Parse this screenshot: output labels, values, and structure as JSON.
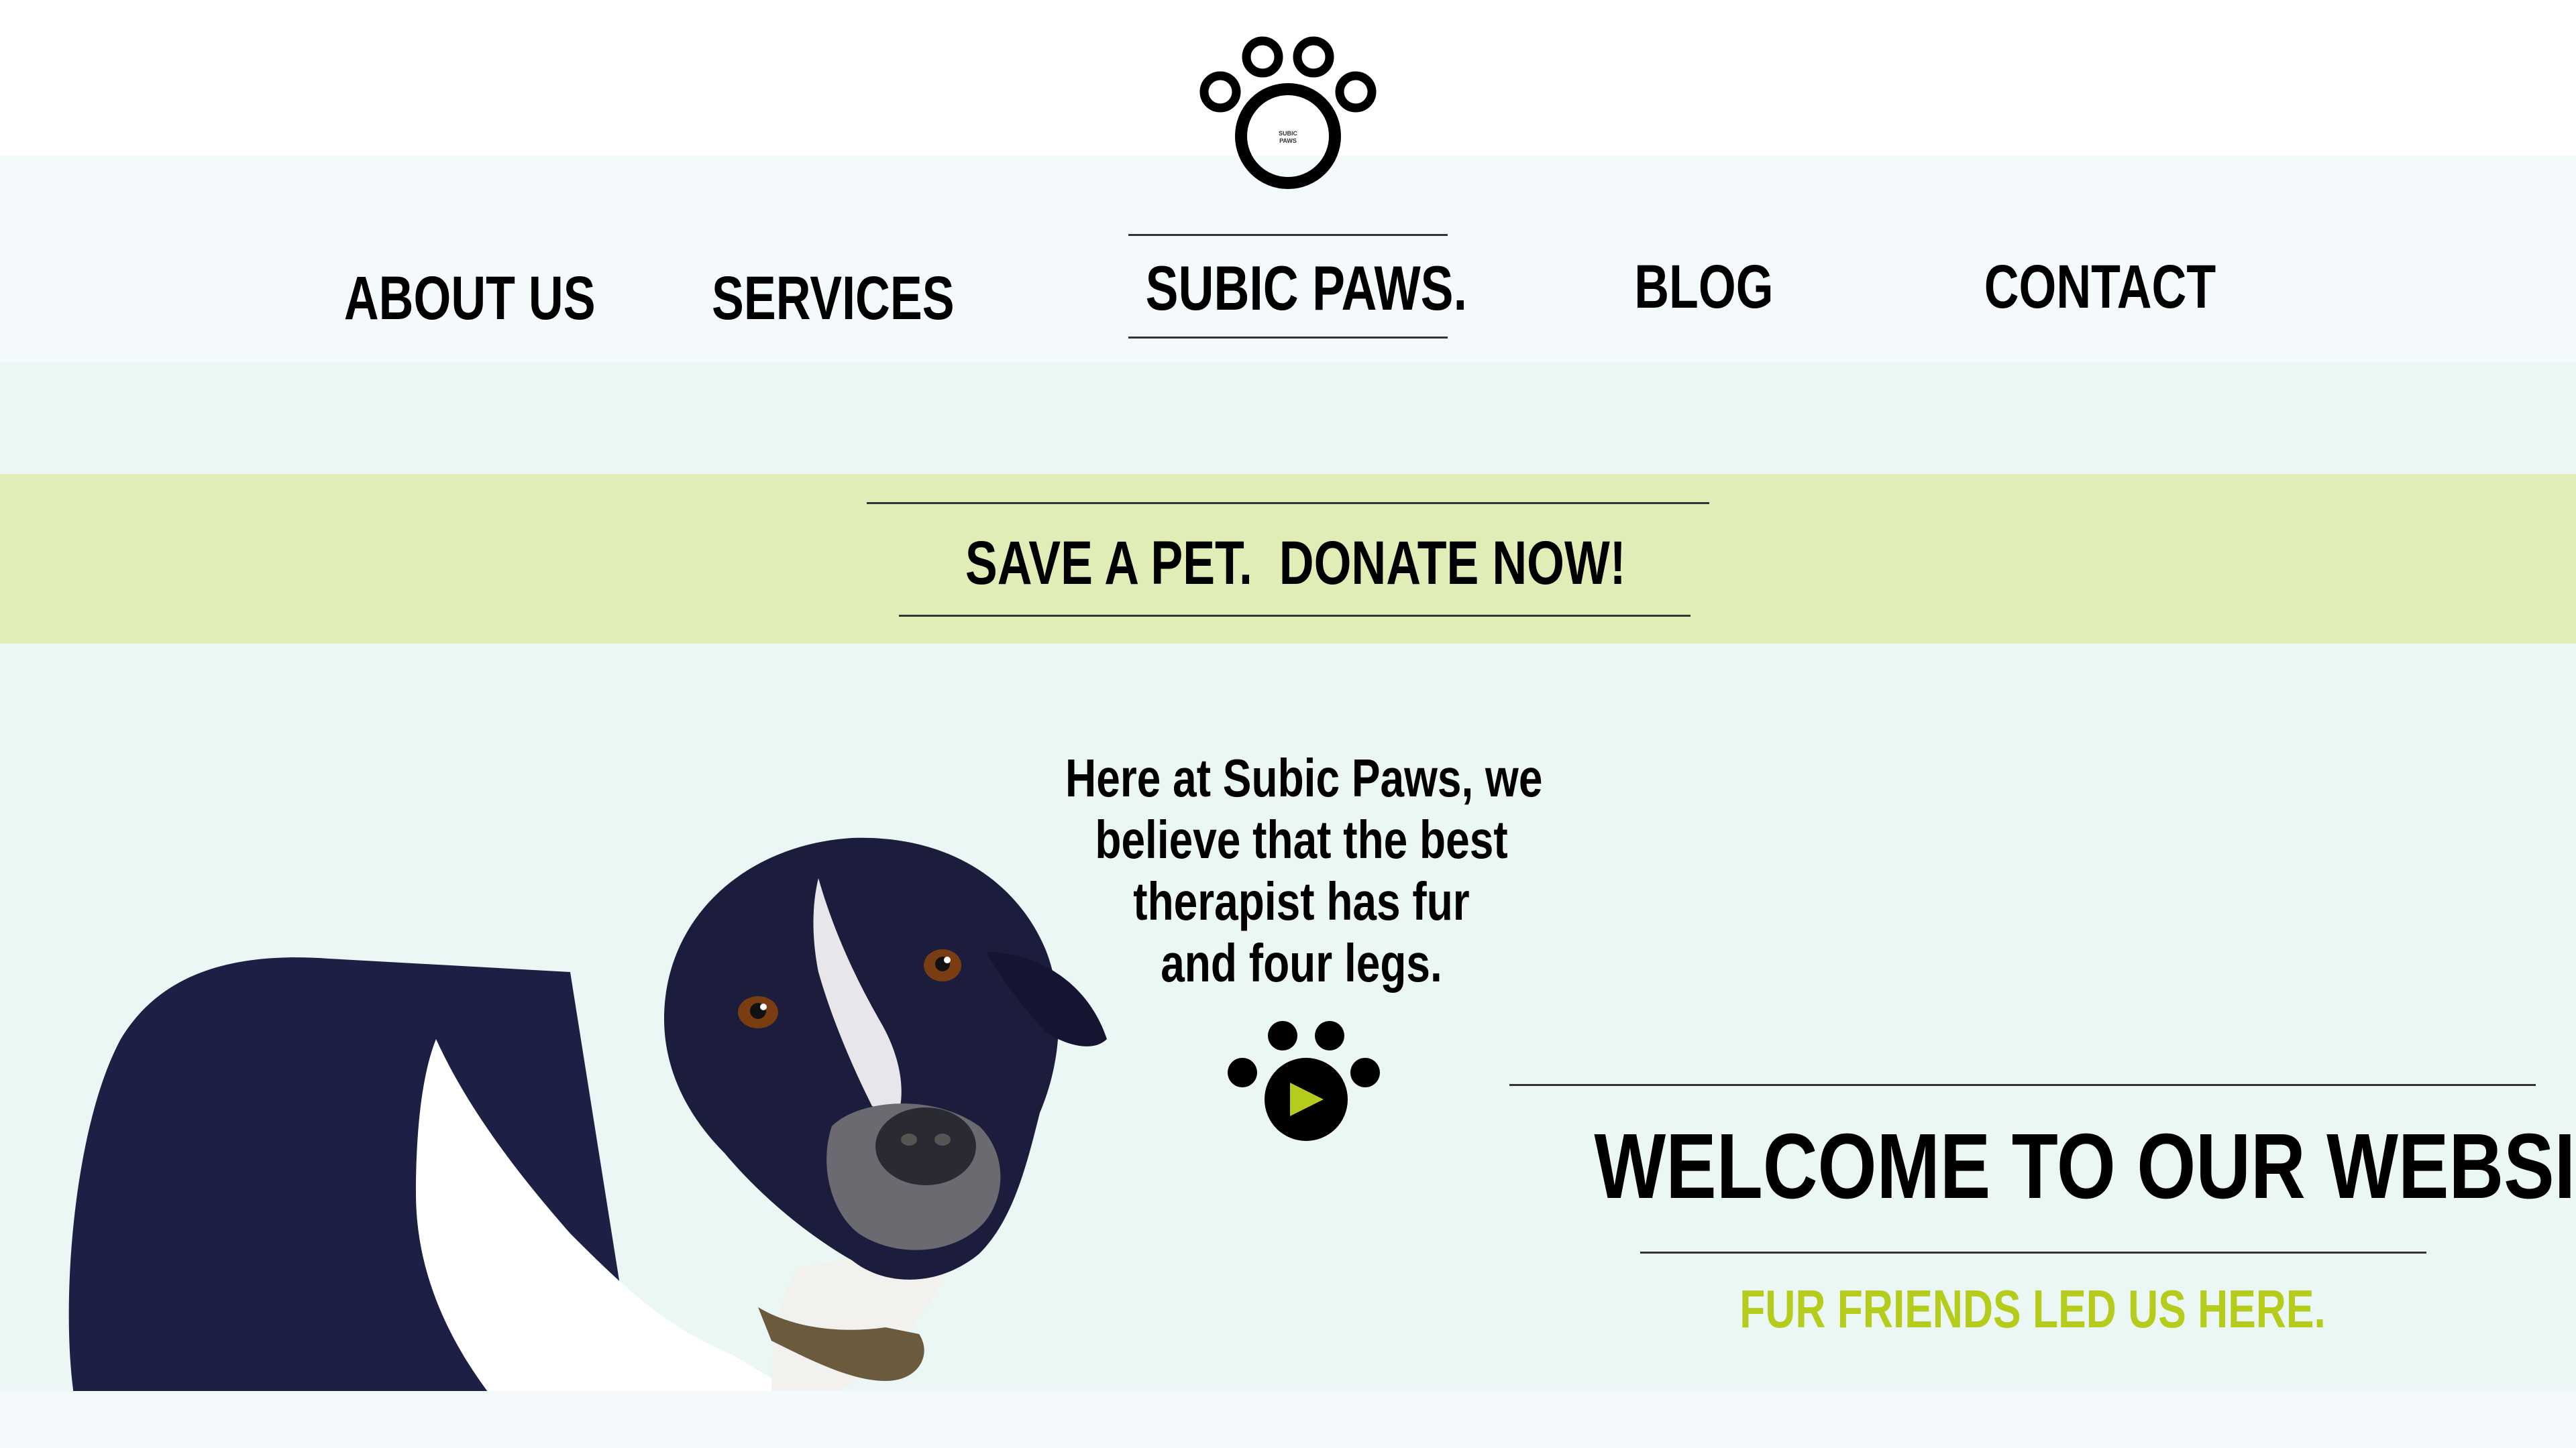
{
  "logo": {
    "text_line1": "SUBIC",
    "text_line2": "PAWS",
    "icon": "paw-logo-icon"
  },
  "nav": {
    "items": [
      {
        "label": "ABOUT US"
      },
      {
        "label": "SERVICES"
      },
      {
        "label": "SUBIC PAWS."
      },
      {
        "label": "BLOG"
      },
      {
        "label": "CONTACT"
      }
    ]
  },
  "donate": {
    "label": "SAVE A PET.  DONATE NOW!"
  },
  "hero": {
    "tagline_lines": [
      "Here at Subic Paws, we",
      "believe that the best",
      "therapist has fur",
      "and four legs."
    ],
    "play_icon": "paw-play-icon",
    "dog_image": "dog-photo"
  },
  "welcome": {
    "title": "WELCOME TO OUR WEBSITE",
    "subtitle": "FUR FRIENDS LED US HERE."
  },
  "colors": {
    "nav_band": "#f4fafc",
    "main_bg": "#ebf7f5",
    "donate_band": "#e0edb6",
    "accent_green": "#b5cc1c",
    "text": "#000000"
  }
}
